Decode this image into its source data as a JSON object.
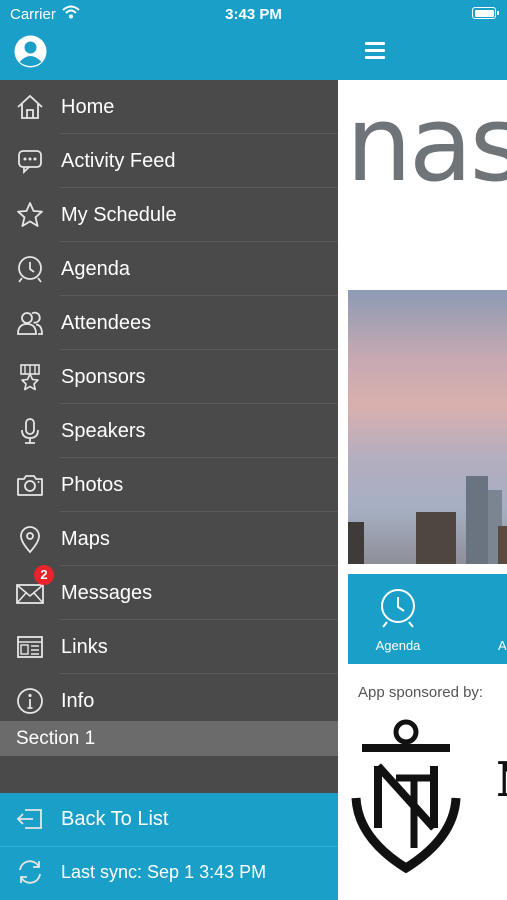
{
  "status_bar": {
    "carrier": "Carrier",
    "time": "3:43 PM"
  },
  "drawer": {
    "menu": [
      {
        "label": "Home",
        "icon": "home-icon"
      },
      {
        "label": "Activity Feed",
        "icon": "chat-bubble-icon"
      },
      {
        "label": "My Schedule",
        "icon": "star-icon"
      },
      {
        "label": "Agenda",
        "icon": "clock-icon"
      },
      {
        "label": "Attendees",
        "icon": "people-icon"
      },
      {
        "label": "Sponsors",
        "icon": "sponsor-badge-icon"
      },
      {
        "label": "Speakers",
        "icon": "microphone-icon"
      },
      {
        "label": "Photos",
        "icon": "camera-icon"
      },
      {
        "label": "Maps",
        "icon": "map-pin-icon"
      },
      {
        "label": "Messages",
        "icon": "envelope-icon",
        "badge": "2"
      },
      {
        "label": "Links",
        "icon": "browser-window-icon"
      },
      {
        "label": "Info",
        "icon": "info-icon"
      }
    ],
    "section_label": "Section 1",
    "footer": {
      "back_label": "Back To List",
      "sync_label": "Last sync:  Sep 1 3:43 PM"
    }
  },
  "main": {
    "logo_text": "nas",
    "tiles": [
      {
        "label": "Agenda",
        "icon": "clock-icon"
      },
      {
        "label": "A"
      }
    ],
    "sponsor_label": "App sponsored by:",
    "sponsor_logo_text": "N"
  },
  "colors": {
    "accent": "#1a9fc8",
    "drawer_bg": "#4a4a4a",
    "badge": "#e8232a",
    "section_bg": "#6b6b6b"
  }
}
